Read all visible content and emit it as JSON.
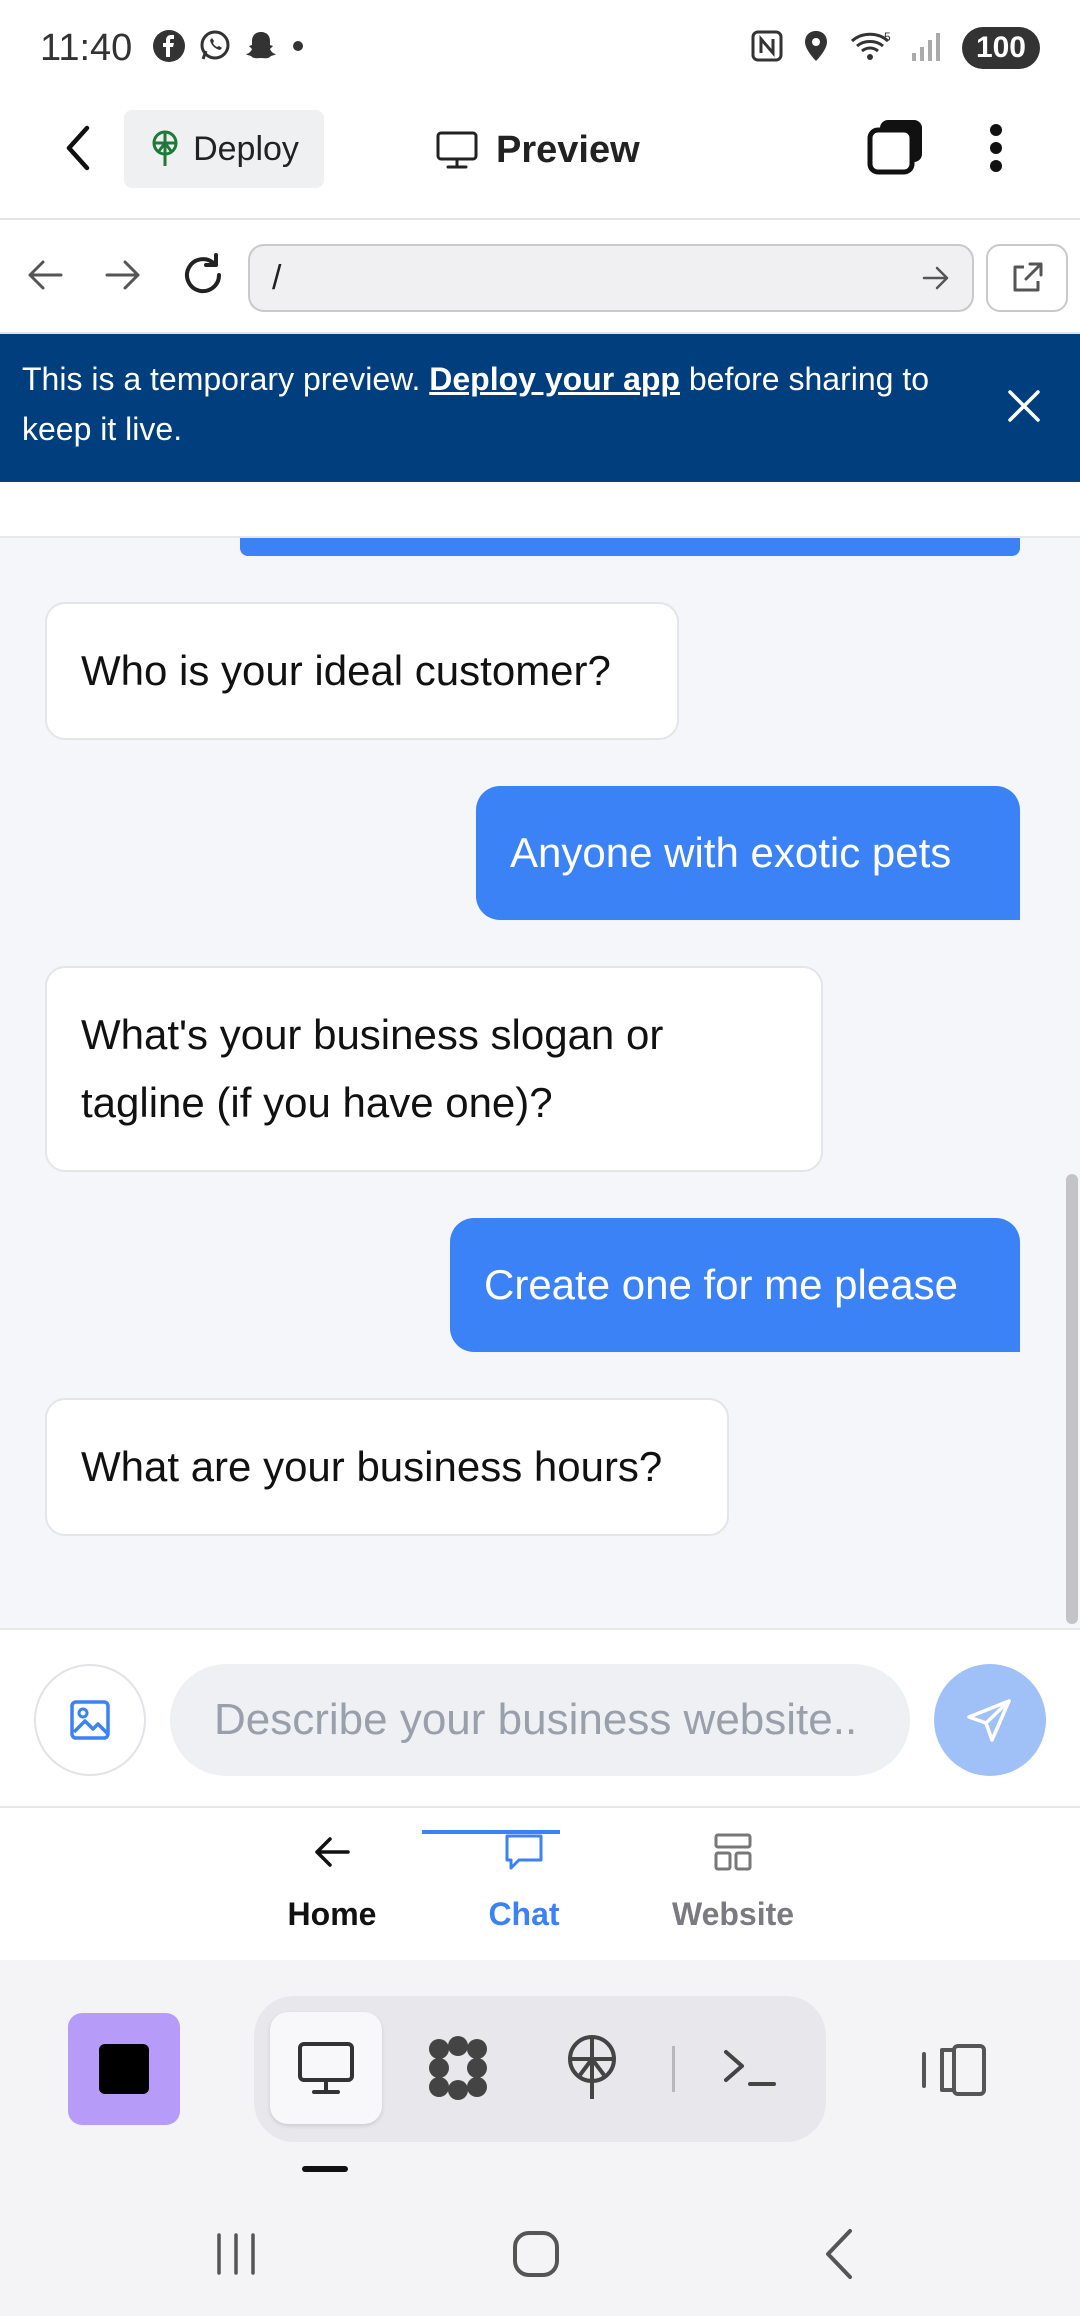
{
  "status_bar": {
    "time": "11:40",
    "battery": "100",
    "notification_icons": [
      "facebook-icon",
      "whatsapp-icon",
      "snapchat-icon",
      "dot-icon"
    ],
    "system_icons": [
      "nfc-icon",
      "location-icon",
      "wifi-icon",
      "signal-icon"
    ]
  },
  "app_bar": {
    "deploy_label": "Deploy",
    "preview_label": "Preview"
  },
  "url_bar": {
    "value": "/"
  },
  "banner": {
    "text_before": "This is a temporary preview. ",
    "link_text": "Deploy your app",
    "text_after": " before sharing to keep it live."
  },
  "messages": [
    {
      "role": "bot",
      "text": "Who is your ideal customer?"
    },
    {
      "role": "user",
      "text": "Anyone with exotic pets"
    },
    {
      "role": "bot",
      "text": "What's your business slogan or tagline (if you have one)?"
    },
    {
      "role": "user",
      "text": "Create one for me please"
    },
    {
      "role": "bot",
      "text": "What are your business hours?"
    }
  ],
  "composer": {
    "placeholder": "Describe your business website.."
  },
  "tabs": [
    {
      "label": "Home",
      "active": false
    },
    {
      "label": "Chat",
      "active": true
    },
    {
      "label": "Website",
      "active": false
    }
  ],
  "colors": {
    "accent": "#3b82f6",
    "banner": "#003e7e",
    "send_button": "#9fc1f8",
    "app_tile": "#b69cf8"
  }
}
